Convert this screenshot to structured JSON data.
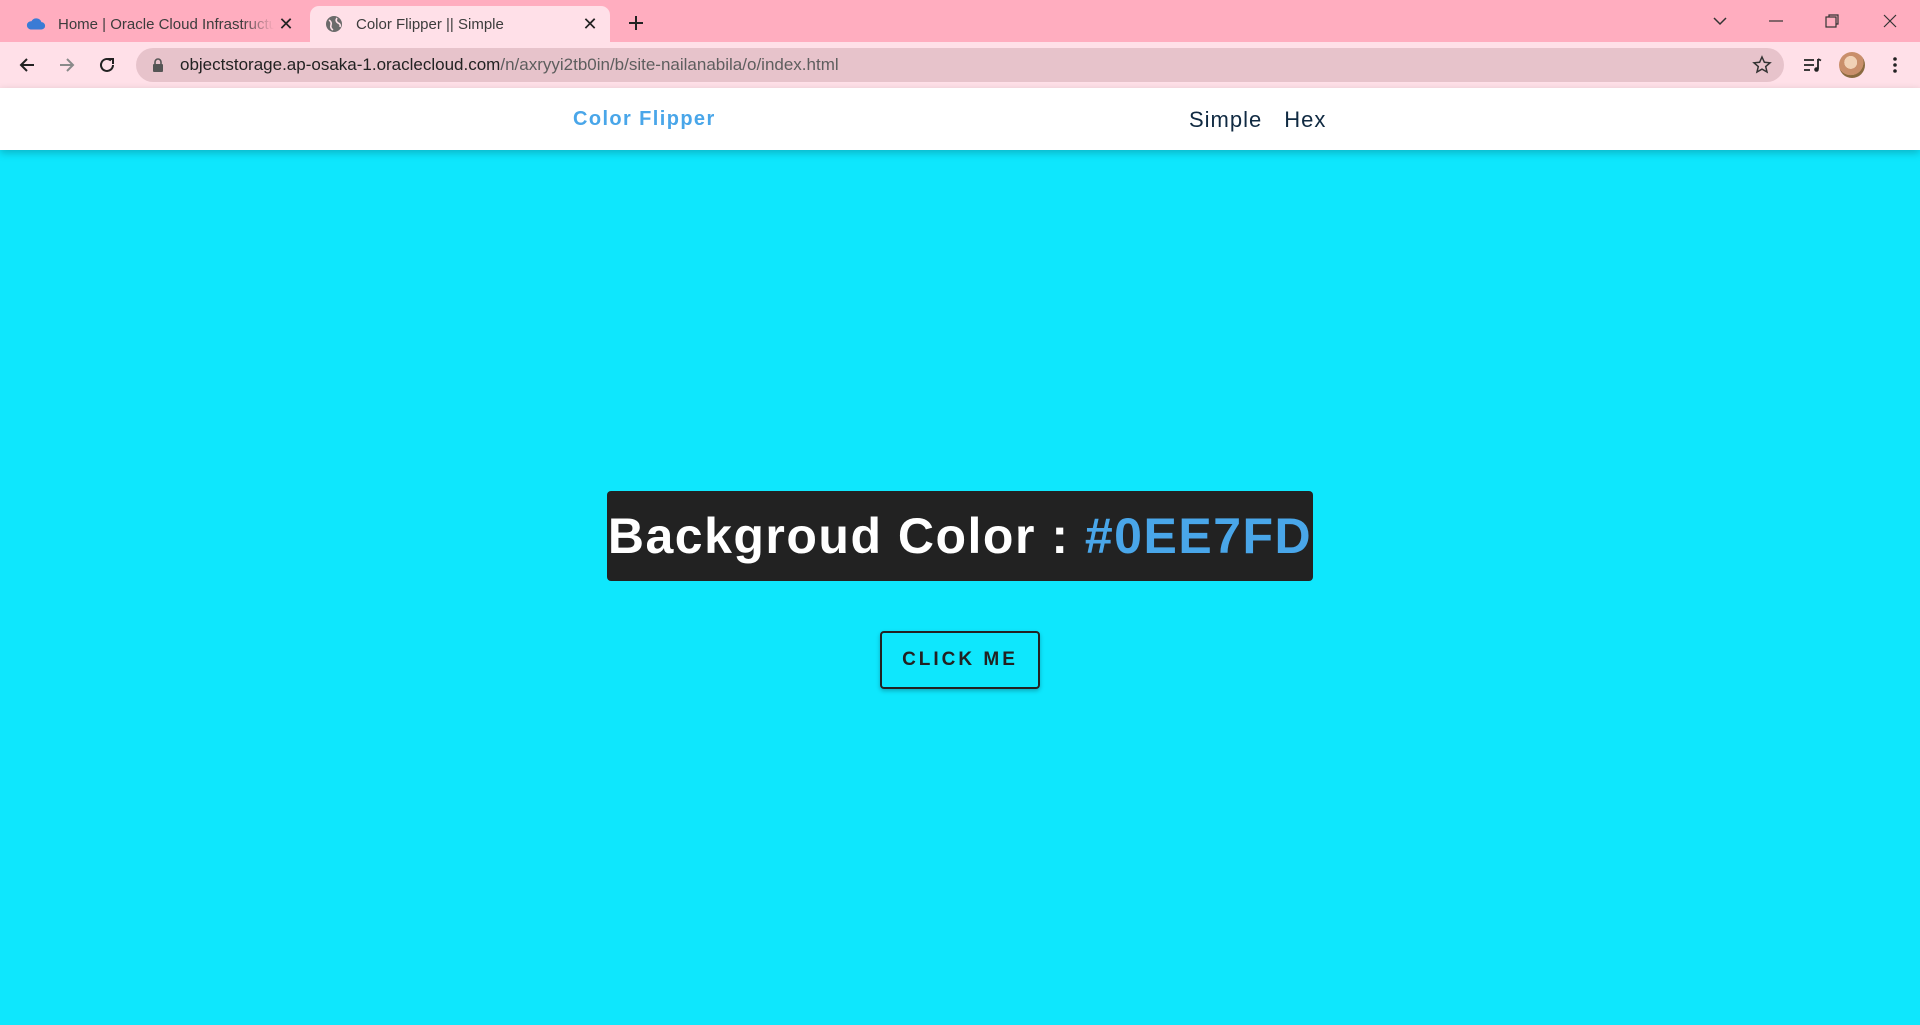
{
  "browser": {
    "tabs": [
      {
        "title": "Home | Oracle Cloud Infrastructure",
        "favicon": "cloud-icon",
        "active": false
      },
      {
        "title": "Color Flipper || Simple",
        "favicon": "globe-icon",
        "active": true
      }
    ],
    "address_bar": {
      "url_host": "objectstorage.ap-osaka-1.oraclecloud.com",
      "url_path": "/n/axryyi2tb0in/b/site-nailanabila/o/index.html"
    },
    "colors": {
      "tabstrip": "#FFADBF",
      "toolbar": "#FFE0E8",
      "omnibox": "#E7C3CB"
    }
  },
  "navbar": {
    "brand": "Color Flipper",
    "links": [
      "Simple",
      "Hex"
    ]
  },
  "main": {
    "label": "Backgroud Color : ",
    "color_value": "#0EE7FD",
    "button_label": "CLICK ME"
  },
  "colors": {
    "background": "#0EE7FD",
    "accent": "#49A6E9",
    "dark": "#222222",
    "nav_text": "#102A42"
  }
}
